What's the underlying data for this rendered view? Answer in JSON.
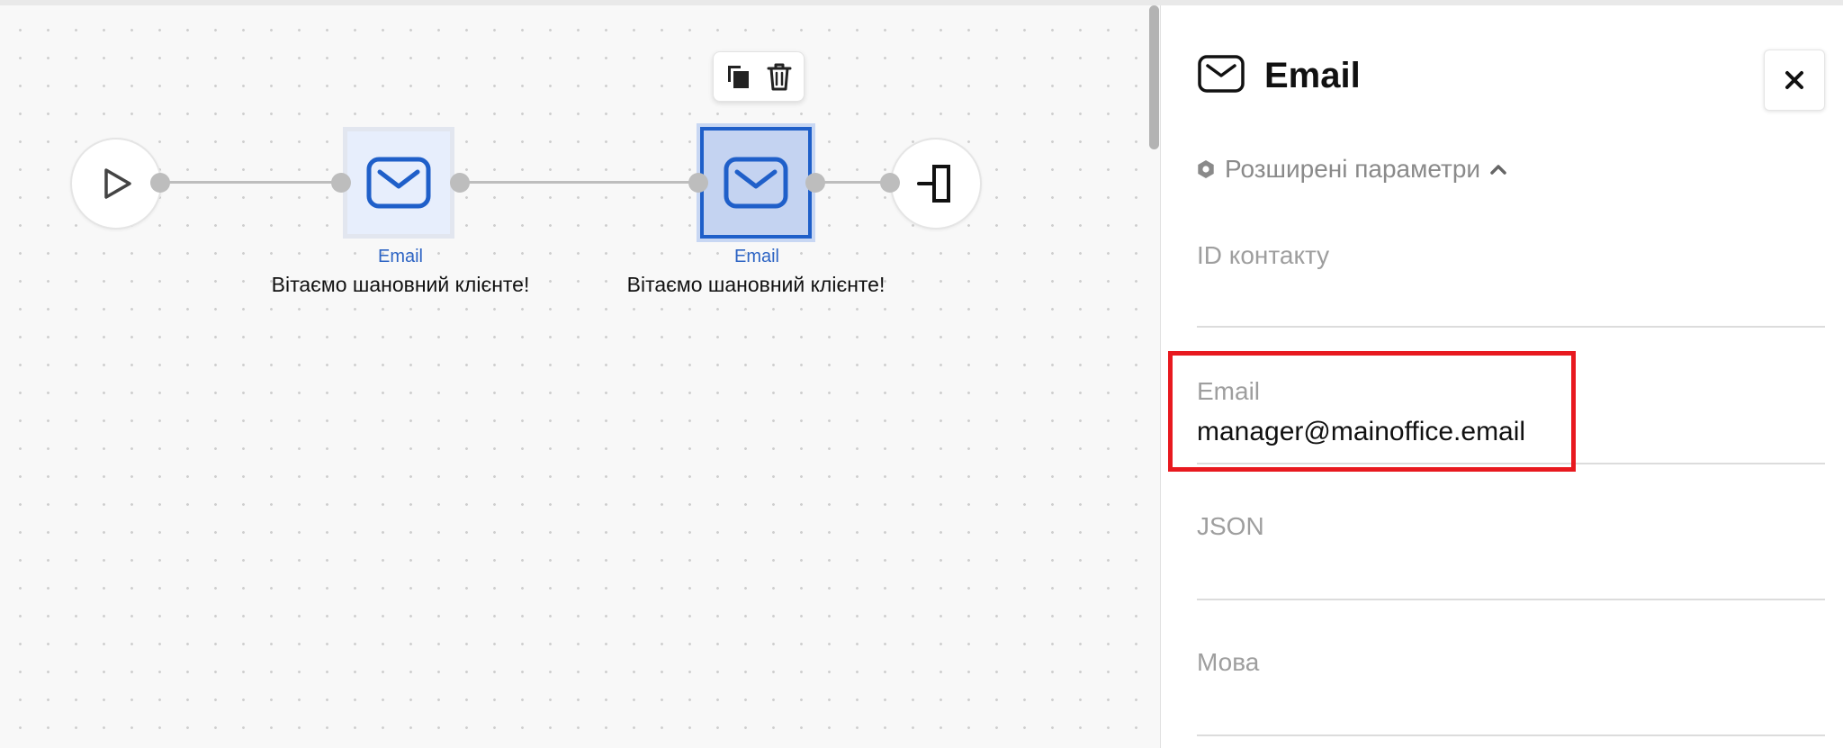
{
  "canvas": {
    "nodes": [
      {
        "type_label": "Email",
        "text": "Вітаємо шановний клієнте!"
      },
      {
        "type_label": "Email",
        "text": "Вітаємо шановний клієнте!"
      }
    ],
    "start_icon": "play-icon",
    "end_icon": "exit-icon",
    "toolbar": {
      "copy_icon": "copy-icon",
      "delete_icon": "trash-icon"
    }
  },
  "panel": {
    "icon": "envelope-icon",
    "title": "Email",
    "close_icon": "close-icon",
    "advanced_params": {
      "label": "Розширені параметри",
      "icon": "gear-icon",
      "toggle_icon": "chevron-up-icon"
    },
    "fields": [
      {
        "label": "ID контакту",
        "value": ""
      },
      {
        "label": "Email",
        "value": "manager@mainoffice.email"
      },
      {
        "label": "JSON",
        "value": ""
      },
      {
        "label": "Мова",
        "value": ""
      }
    ]
  },
  "colors": {
    "accent": "#1f5fc9",
    "highlight": "#e8191f",
    "node_bg": "#e7eefc",
    "node_selected_bg": "#c4d3f1"
  }
}
